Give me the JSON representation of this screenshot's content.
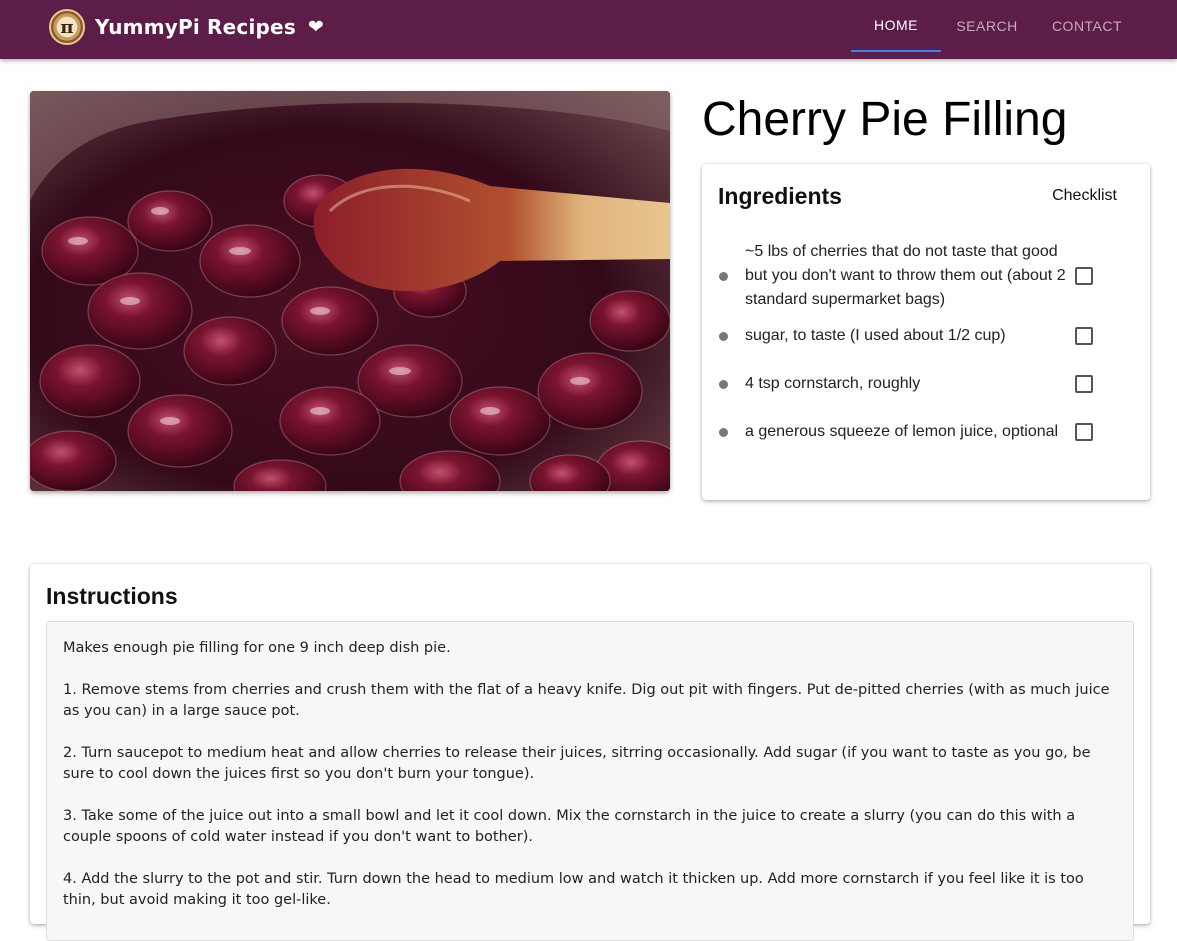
{
  "brand": {
    "logo_glyph": "π",
    "title": "YummyPi Recipes",
    "heart_icon": "heart-icon"
  },
  "nav": {
    "items": [
      {
        "label": "HOME",
        "active": true
      },
      {
        "label": "SEARCH",
        "active": false
      },
      {
        "label": "CONTACT",
        "active": false
      }
    ]
  },
  "hero": {
    "image_subject": "cherry pie filling in pot with wooden spoon"
  },
  "recipe": {
    "title": "Cherry Pie Filling"
  },
  "ingredients": {
    "heading": "Ingredients",
    "checklist_label": "Checklist",
    "items": [
      {
        "text": "~5 lbs of cherries that do not taste that good but you don't want to throw them out (about 2 standard supermarket bags)",
        "checked": false
      },
      {
        "text": "sugar, to taste (I used about 1/2 cup)",
        "checked": false
      },
      {
        "text": "4 tsp cornstarch, roughly",
        "checked": false
      },
      {
        "text": "a generous squeeze of lemon juice, optional",
        "checked": false
      }
    ]
  },
  "instructions": {
    "heading": "Instructions",
    "paragraphs": [
      "Makes enough pie filling for one 9 inch deep dish pie.",
      "1. Remove stems from cherries and crush them with the flat of a heavy knife. Dig out pit with fingers. Put de-pitted cherries (with as much juice as you can) in a large sauce pot.",
      "2. Turn saucepot to medium heat and allow cherries to release their juices, sitrring occasionally. Add sugar (if you want to taste as you go, be sure to cool down the juices first so you don't burn your tongue).",
      "3. Take some of the juice out into a small bowl and let it cool down. Mix the cornstarch in the juice to create a slurry (you can do this with a couple spoons of cold water instead if you don't want to bother).",
      "4. Add the slurry to the pot and stir. Turn down the head to medium low and watch it thicken up. Add more cornstarch if you feel like it is too thin, but avoid making it too gel-like."
    ]
  },
  "colors": {
    "appbar": "#5c1e48",
    "active_tab_indicator": "#3b82f6",
    "nav_inactive": "#c9a9bf"
  }
}
